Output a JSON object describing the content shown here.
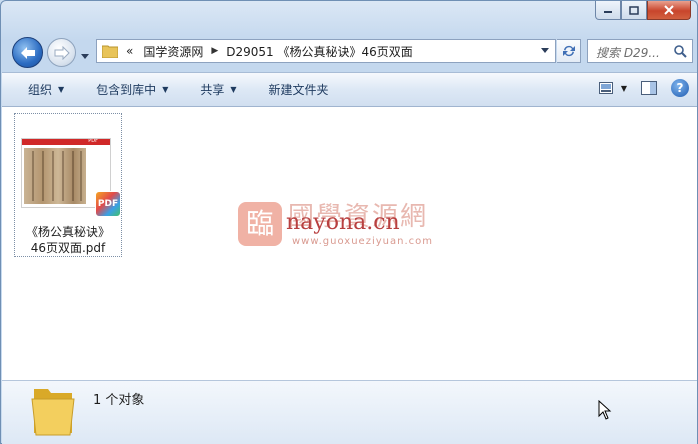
{
  "address": {
    "overflow": "«",
    "crumbs": [
      "国学资源网",
      "D29051 《杨公真秘诀》46页双面"
    ]
  },
  "search": {
    "placeholder": "搜索 D29..."
  },
  "toolbar": {
    "organize": "组织",
    "include_library": "包含到库中",
    "share": "共享",
    "new_folder": "新建文件夹"
  },
  "file": {
    "badge": "PDF",
    "thumb_label": "PDF",
    "name_line1": "《杨公真秘诀》",
    "name_line2": "46页双面.pdf"
  },
  "watermark": {
    "logo": "臨",
    "title": "國學資源網",
    "domain": "nayona.cn",
    "url": "www.guoxueziyuan.com"
  },
  "status": {
    "count": "1 个对象"
  },
  "icons": {
    "back": "back-arrow-icon",
    "forward": "forward-arrow-icon",
    "folder": "folder-icon",
    "refresh": "refresh-icon",
    "search": "search-icon",
    "help": "help-icon"
  },
  "colors": {
    "accent": "#2c6cc2",
    "close": "#c8452c",
    "pdf_bar": "#d02828"
  }
}
